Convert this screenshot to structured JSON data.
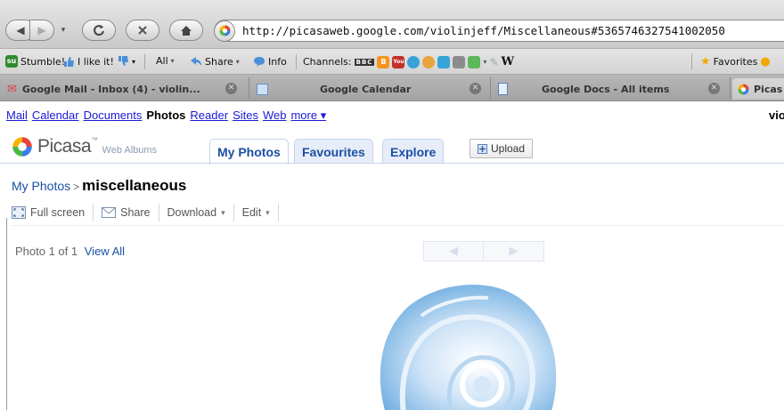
{
  "browser": {
    "url": "http://picasaweb.google.com/violinjeff/Miscellaneous#5365746327541002050",
    "bookmarks": [
      {
        "label": "Stumble!",
        "icon": "stumbleupon-icon",
        "color": "#2e8b2e",
        "glyph": "su"
      },
      {
        "label": "I like it!",
        "icon": "thumbs-up-icon"
      },
      {
        "label": "All",
        "icon": "stumble-all-icon"
      },
      {
        "label": "Share",
        "icon": "share-icon"
      },
      {
        "label": "Info",
        "icon": "info-icon"
      },
      {
        "label": "Channels:",
        "icon": "channels-icon"
      },
      {
        "label": "Favorites",
        "icon": "star-icon"
      }
    ],
    "channel_badge": "BBC",
    "tabs": [
      {
        "label": "Google Mail - Inbox (4) - violin...",
        "icon": "gmail-icon"
      },
      {
        "label": "Google Calendar",
        "icon": "calendar-icon"
      },
      {
        "label": "Google Docs - All items",
        "icon": "docs-icon"
      },
      {
        "label": "Picas",
        "icon": "picasa-icon"
      }
    ]
  },
  "gbar": {
    "links": [
      "Mail",
      "Calendar",
      "Documents",
      "Photos",
      "Reader",
      "Sites",
      "Web",
      "more ▾"
    ],
    "active": "Photos",
    "user": "vio"
  },
  "header": {
    "logo_text": "Picasa",
    "logo_tm": "™",
    "logo_sub": "Web Albums",
    "tabs": {
      "my_photos": "My Photos",
      "favourites": "Favourites",
      "explore": "Explore"
    },
    "upload_label": "Upload"
  },
  "breadcrumb": {
    "link": "My Photos",
    "separator": ">",
    "title": "miscellaneous"
  },
  "actions": {
    "fullscreen": "Full screen",
    "share": "Share",
    "download": "Download",
    "edit": "Edit"
  },
  "photo_nav": {
    "count_text": "Photo 1 of 1",
    "view_all": "View All",
    "prev": "◀",
    "next": "▶"
  },
  "colors": {
    "link": "#1a4fa3",
    "gbar_link": "#1a1ad6",
    "tab_bg": "#e6edf9"
  }
}
